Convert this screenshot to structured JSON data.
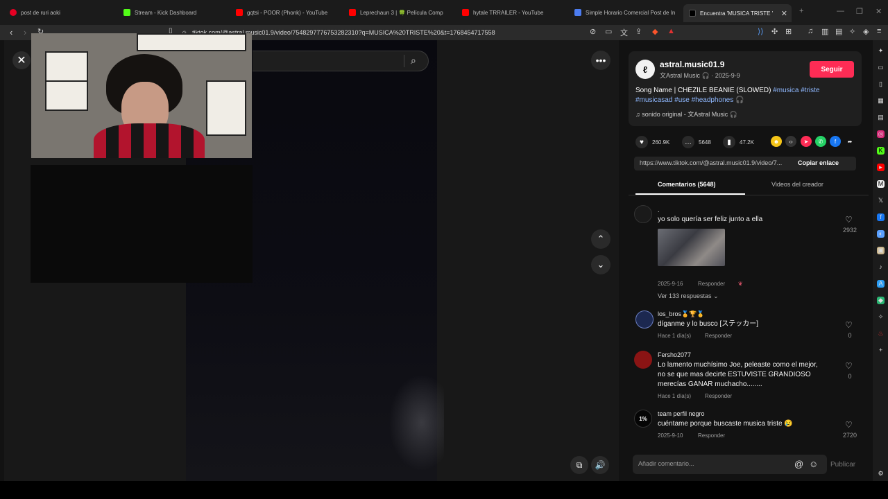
{
  "browser": {
    "tabs": [
      {
        "title": "post de ruri aoki",
        "color": "#e60023"
      },
      {
        "title": "Stream - Kick Dashboard",
        "color": "#53fc18"
      },
      {
        "title": "gqtsi - POOR (Phonk) - YouTube",
        "color": "#ff0000"
      },
      {
        "title": "Leprechaun 3 | 🍀 Película Comp",
        "color": "#ff0000"
      },
      {
        "title": "hytale TRRAILER - YouTube",
        "color": "#ff0000"
      },
      {
        "title": "Simple Horario Comercial Post de In",
        "color": "#4c7cf0"
      },
      {
        "title": "Encuentra 'MUSICA TRISTE '",
        "color": "#222222"
      }
    ],
    "url": "tiktok.com/@astral.music01.9/video/7548297776753282310?q=MUSICA%20TRISTE%20&t=1768454717558"
  },
  "post": {
    "username": "astral.music01.9",
    "nickname": "文Astral Music 🎧",
    "date": "2025-9-9",
    "follow_label": "Seguir",
    "description_prefix": "Song Name | CHEZILE BEANIE (SLOWED)",
    "hashtags_line1": "#musica #triste",
    "hashtags_line2": "#musicasad #use #headphones",
    "headphones_emoji": "🎧",
    "music": "sonido original - 文Astral Music 🎧",
    "likes": "260.9K",
    "comments_count": "5648",
    "saves": "47.2K",
    "share_link": "https://www.tiktok.com/@astral.music01.9/video/7...",
    "copy_link_label": "Copiar enlace",
    "tab_comments": "Comentarios (5648)",
    "tab_creator": "Videos del creador"
  },
  "comments": [
    {
      "name": ".",
      "text": "yo solo quería ser feliz junto a ella",
      "date": "2025-9-16",
      "reply": "Responder",
      "likes": "2932",
      "view_replies": "Ver 133 respuestas"
    },
    {
      "name": "los_bros🏅🏆🥇",
      "text": "díganme y lo busco [ステッカー]",
      "date": "Hace 1 día(s)",
      "reply": "Responder",
      "likes": "0"
    },
    {
      "name": "Fersho2077",
      "text_lines": [
        "Lo lamento muchísimo Joe, peleaste como el mejor,",
        "no se que mas decirte ESTUVISTE GRANDIOSO",
        "merecías GANAR muchacho........"
      ],
      "date": "Hace 1 día(s)",
      "reply": "Responder",
      "likes": "0"
    },
    {
      "name": "team perfil negro",
      "text": "cuéntame porque buscaste musica triste 😢",
      "date": "2025-9-10",
      "reply": "Responder",
      "likes": "2720",
      "avatar_text": "1%"
    }
  ],
  "comment_box": {
    "placeholder": "Añadir comentario...",
    "publish_label": "Publicar"
  }
}
